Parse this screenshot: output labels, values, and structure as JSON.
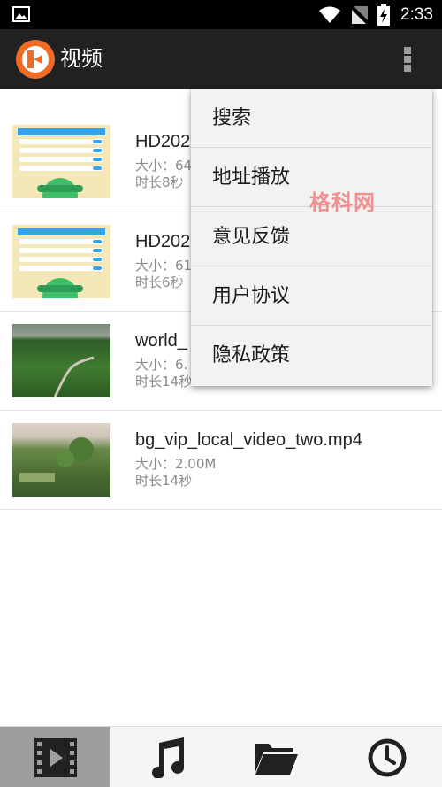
{
  "status_bar": {
    "time": "2:33",
    "icons": [
      "image-icon",
      "wifi-icon",
      "no-sim-icon",
      "battery-charging-icon"
    ]
  },
  "toolbar": {
    "title": "视频",
    "logo_icon": "app-logo-icon",
    "overflow_icon": "more-vert-icon"
  },
  "videos": [
    {
      "name": "HD202",
      "size": "大小：64",
      "duration": "时长8秒",
      "thumb": "app-screenshot"
    },
    {
      "name": "HD202",
      "size": "大小：61",
      "duration": "时长6秒",
      "thumb": "app-screenshot"
    },
    {
      "name": "world_",
      "size": "大小：6.",
      "duration": "时长14秒",
      "thumb": "landscape"
    },
    {
      "name": "bg_vip_local_video_two.mp4",
      "size": "大小：2.00M",
      "duration": "时长14秒",
      "thumb": "landscape"
    }
  ],
  "menu": {
    "items": [
      "搜索",
      "地址播放",
      "意见反馈",
      "用户协议",
      "隐私政策"
    ]
  },
  "watermark": "格科网",
  "bottom_nav": {
    "tabs": [
      {
        "icon": "video-film-icon",
        "active": true
      },
      {
        "icon": "music-note-icon",
        "active": false
      },
      {
        "icon": "folder-open-icon",
        "active": false
      },
      {
        "icon": "clock-history-icon",
        "active": false
      }
    ]
  },
  "colors": {
    "toolbar": "#212121",
    "accent": "#ef6c27",
    "active_tab": "#9e9e9e"
  }
}
